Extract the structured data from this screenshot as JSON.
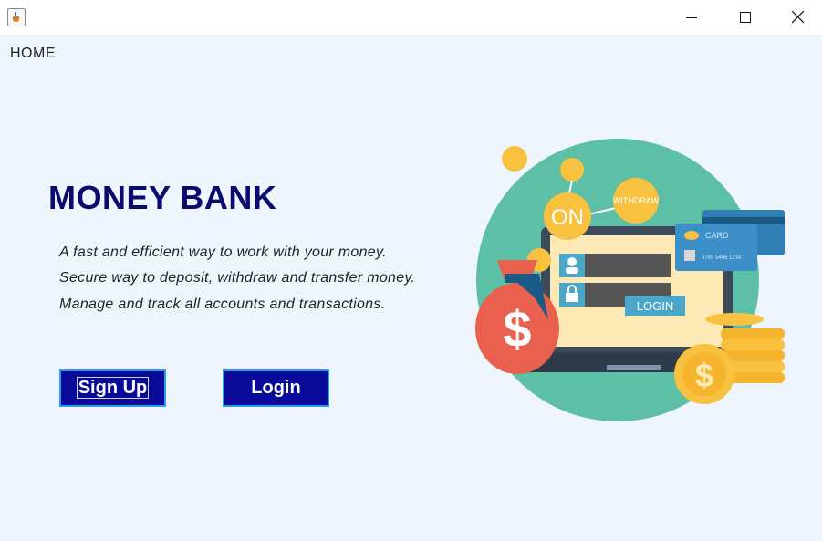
{
  "window": {
    "app_icon": "java-coffee-icon",
    "controls": {
      "minimize": "minimize-icon",
      "maximize": "maximize-icon",
      "close": "close-icon"
    }
  },
  "nav": {
    "home_label": "HOME"
  },
  "hero": {
    "title": "MONEY BANK",
    "taglines": [
      "A fast and efficient way to work with your money.",
      "Secure way to deposit, withdraw and transfer money.",
      "Manage and track all accounts and transactions."
    ]
  },
  "buttons": {
    "signup": "Sign Up",
    "login": "Login"
  },
  "illustration": {
    "on_label": "ON",
    "withdraw_label": "WITHDRAW",
    "login_label": "LOGIN",
    "card_label": "CARD",
    "card_number": "6789 5466 1234",
    "dollar_sign": "$"
  },
  "colors": {
    "background": "#eef5fc",
    "title": "#0b0b6e",
    "button_fill": "#0a0a98",
    "button_border": "#2a9cf0",
    "teal_circle": "#5dbfa5",
    "coin": "#f8c240",
    "money_bag": "#e9604f"
  }
}
